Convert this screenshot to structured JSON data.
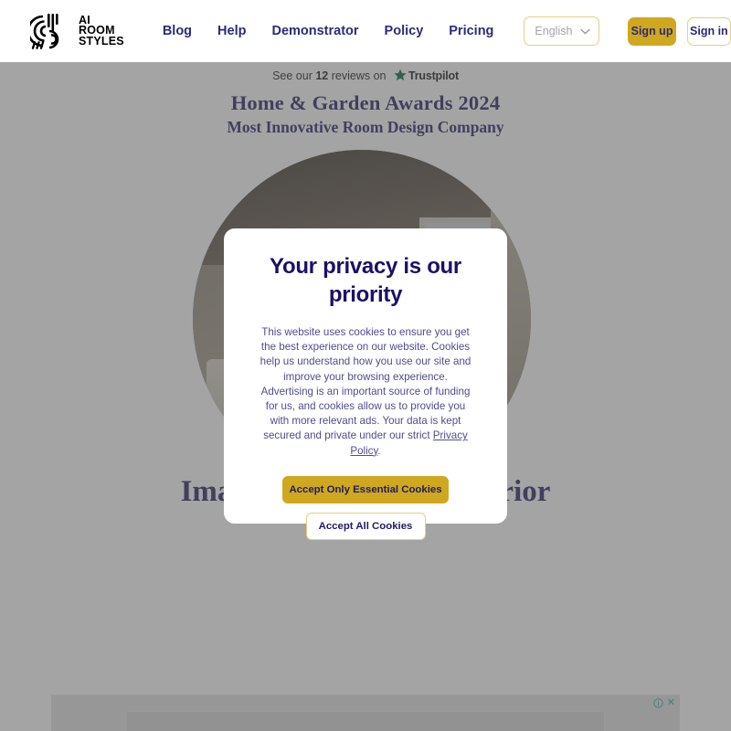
{
  "header": {
    "logo": {
      "icon": "ai-room-styles-logo-mark",
      "line1": "AI",
      "line2": "ROOM",
      "line3": "STYLES"
    },
    "nav": [
      {
        "label": "Blog"
      },
      {
        "label": "Help"
      },
      {
        "label": "Demonstrator"
      },
      {
        "label": "Policy"
      },
      {
        "label": "Pricing"
      }
    ],
    "language_select": {
      "value": "English",
      "icon": "chevron-down-icon"
    },
    "sign_up_label": "Sign up",
    "sign_in_label": "Sign in"
  },
  "hero": {
    "trustpilot": {
      "prefix": "See our",
      "count": "12",
      "middle": "reviews on",
      "star_icon": "star-icon",
      "brand": "Trustpilot",
      "star_color": "#00693d"
    },
    "award_line1": "Home & Garden Awards 2024",
    "award_line2": "Most Innovative Room Design Company",
    "image_alt": "room-interior-photo",
    "title": "Imagine your dream interior"
  },
  "cookie_modal": {
    "title": "Your privacy is our priority",
    "body_part1": "This website uses cookies to ensure you get the best experience on our website. Cookies help us understand how you use our site and improve your browsing experience. Advertising is an important source of funding for us, and cookies allow us to provide you with more relevant ads. Your data is kept secured and private under our strict ",
    "policy_link": "Privacy Policy",
    "body_part2": ".",
    "accept_essential_label": "Accept Only Essential Cookies",
    "accept_all_label": "Accept All Cookies"
  },
  "ad_banner": {
    "adchoices_icon": "adchoices-info-icon",
    "close_label": "✕"
  },
  "colors": {
    "brand_navy": "#2d2a7a",
    "brand_gold": "#cfa81f",
    "gold_border": "#e8cf7f",
    "modal_title": "#1d1065",
    "modal_text": "#514b8f",
    "serif_navy": "#221f63"
  }
}
